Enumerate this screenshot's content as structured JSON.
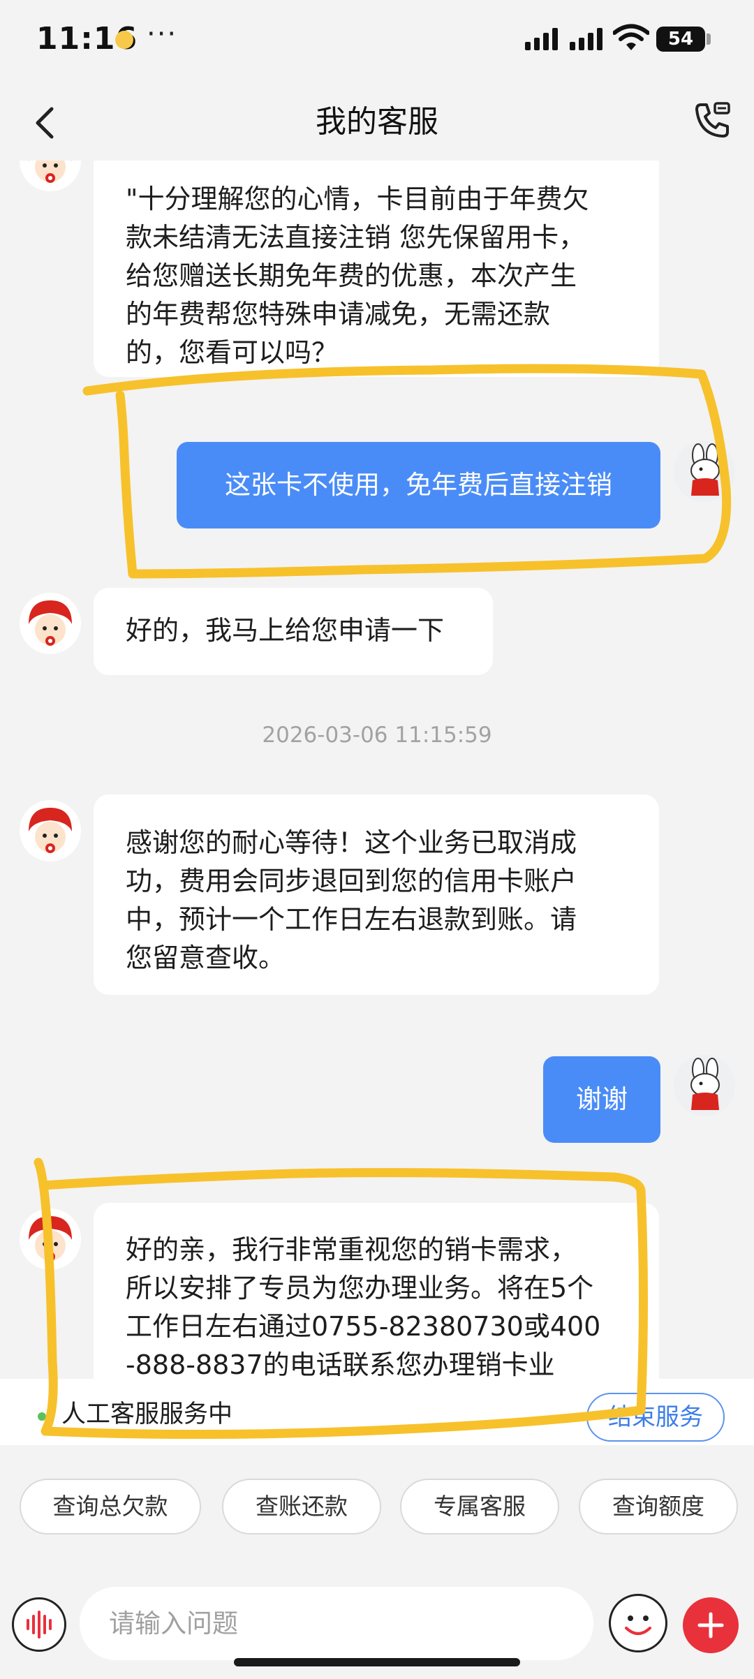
{
  "status_bar": {
    "time": "11:16",
    "more": "···",
    "battery": "54"
  },
  "nav": {
    "title": "我的客服",
    "back_icon": "chevron-left-icon",
    "call_icon": "phone-call-icon"
  },
  "messages": [
    {
      "from": "agent",
      "text": "\"十分理解您的心情，卡目前由于年费欠\n款未结清无法直接注销 您先保留用卡，\n给您赠送长期免年费的优惠，本次产生\n的年费帮您特殊申请减免，无需还款\n的，您看可以吗？"
    },
    {
      "from": "user",
      "text": "这张卡不使用，免年费后直接注销"
    },
    {
      "from": "agent",
      "text": "好的，我马上给您申请一下"
    },
    {
      "timestamp": "2026-03-06 11:15:59"
    },
    {
      "from": "agent",
      "text": "感谢您的耐心等待！这个业务已取消成\n功，费用会同步退回到您的信用卡账户\n中，预计一个工作日左右退款到账。请\n您留意查收。"
    },
    {
      "from": "user",
      "text": "谢谢"
    },
    {
      "from": "agent",
      "text": "好的亲，我行非常重视您的销卡需求，\n所以安排了专员为您办理业务。将在5个\n工作日左右通过0755-82380730或400\n-888-8837的电话联系您办理销卡业"
    }
  ],
  "service": {
    "status_label": "人工客服服务中",
    "end_button": "结束服务"
  },
  "quick_actions": [
    "查询总欠款",
    "查账还款",
    "专属客服",
    "查询额度"
  ],
  "input": {
    "placeholder": "请输入问题",
    "voice_icon": "voice-wave-icon",
    "emoji_icon": "smiley-icon",
    "plus_icon": "plus-icon"
  },
  "colors": {
    "user_bubble": "#4a8cf7",
    "annotation_highlight": "#f7c12b",
    "plus_button": "#e8313b"
  }
}
